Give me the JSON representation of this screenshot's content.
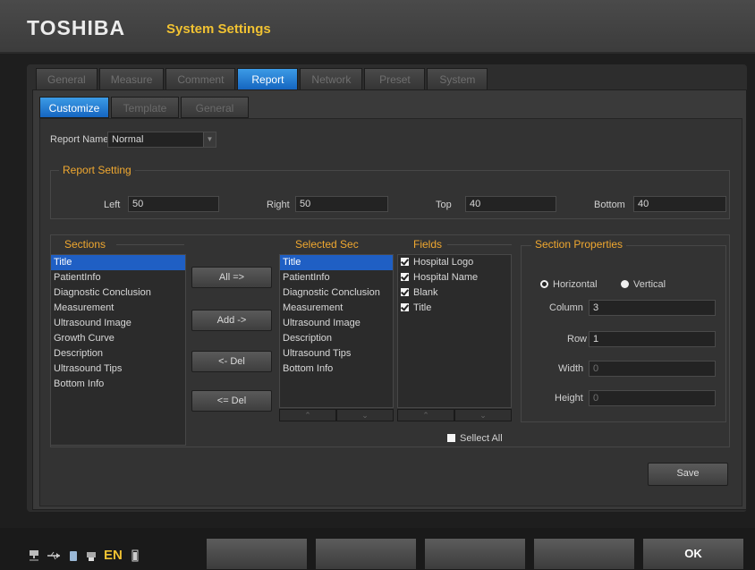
{
  "header": {
    "brand": "TOSHIBA",
    "title": "System Settings"
  },
  "tabs": [
    "General",
    "Measure",
    "Comment",
    "Report",
    "Network",
    "Preset",
    "System"
  ],
  "active_tab": "Report",
  "subtabs": [
    "Customize",
    "Template",
    "General"
  ],
  "active_subtab": "Customize",
  "report_name": {
    "label": "Report Name",
    "value": "Normal"
  },
  "report_setting": {
    "title": "Report Setting",
    "left": {
      "label": "Left",
      "value": "50"
    },
    "right": {
      "label": "Right",
      "value": "50"
    },
    "top": {
      "label": "Top",
      "value": "40"
    },
    "bottom": {
      "label": "Bottom",
      "value": "40"
    }
  },
  "sections": {
    "title": "Sections",
    "items": [
      "Title",
      "PatientInfo",
      "Diagnostic Conclusion",
      "Measurement",
      "Ultrasound Image",
      "Growth Curve",
      "Description",
      "Ultrasound Tips",
      "Bottom Info"
    ],
    "selected_index": 0
  },
  "buttons": {
    "all_add": "All =>",
    "add": "Add ->",
    "del": "<- Del",
    "all_del": "<= Del",
    "save": "Save"
  },
  "selected_sec": {
    "title": "Selected Sec",
    "items": [
      "Title",
      "PatientInfo",
      "Diagnostic Conclusion",
      "Measurement",
      "Ultrasound Image",
      "Description",
      "Ultrasound Tips",
      "Bottom Info"
    ],
    "selected_index": 0
  },
  "fields": {
    "title": "Fields",
    "items": [
      {
        "label": "Hospital Logo",
        "checked": true
      },
      {
        "label": "Hospital Name",
        "checked": true
      },
      {
        "label": "Blank",
        "checked": true
      },
      {
        "label": "Title",
        "checked": true
      }
    ],
    "select_all_label": "Sellect All",
    "select_all_checked": false
  },
  "section_properties": {
    "title": "Section Properties",
    "orientation": {
      "horizontal": "Horizontal",
      "vertical": "Vertical",
      "selected": "Horizontal"
    },
    "column": {
      "label": "Column",
      "value": "3"
    },
    "row": {
      "label": "Row",
      "value": "1"
    },
    "width": {
      "label": "Width",
      "value": "0"
    },
    "height": {
      "label": "Height",
      "value": "0"
    }
  },
  "scroll": {
    "up": "⌃",
    "down": "⌄"
  },
  "footer": {
    "language": "EN",
    "softkeys": [
      "",
      "",
      "",
      "",
      "OK"
    ]
  },
  "colors": {
    "accent_blue": "#1f5fc4",
    "title_yellow": "#f1c232",
    "group_orange": "#f0a830"
  }
}
